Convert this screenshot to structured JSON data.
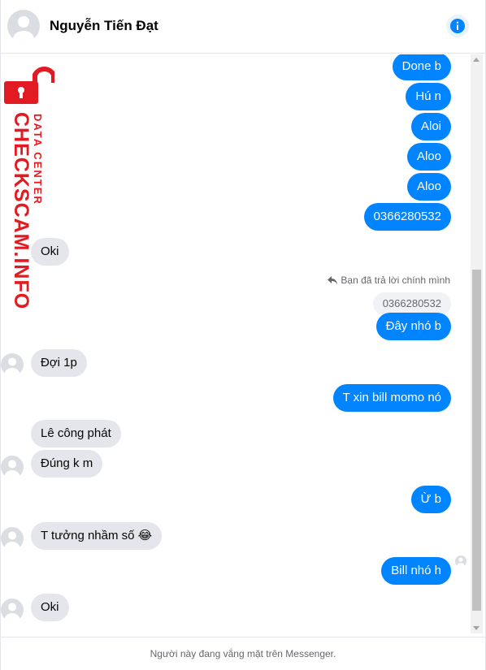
{
  "header": {
    "contact_name": "Nguyễn Tiến Đạt",
    "info_icon": "info-icon"
  },
  "messages": {
    "m1": "Done b",
    "m2": "Hú n",
    "m3": "Aloi",
    "m4": "Aloo",
    "m5": "Aloo",
    "m6": "0366280532",
    "m7": "Oki",
    "reply_meta": "Bạn đã trả lời chính mình",
    "quoted": "0366280532",
    "m8": "Đây nhó b",
    "m9": "Đợi 1p",
    "m10": "T xin bill momo nó",
    "m11": "Lê công phát",
    "m12": "Đúng k m",
    "m13": "Ừ b",
    "m14": "T tưởng nhầm số 😂",
    "m15": "Bill nhó h",
    "m16": "Oki"
  },
  "footer": {
    "status": "Người này đang vắng mặt trên Messenger."
  },
  "watermark": {
    "brand": "CHECKSCAM.INFO",
    "sub": "DATA CENTER"
  },
  "colors": {
    "outgoing": "#0084ff",
    "incoming": "#e4e6eb",
    "brand_red": "#e21b22"
  }
}
